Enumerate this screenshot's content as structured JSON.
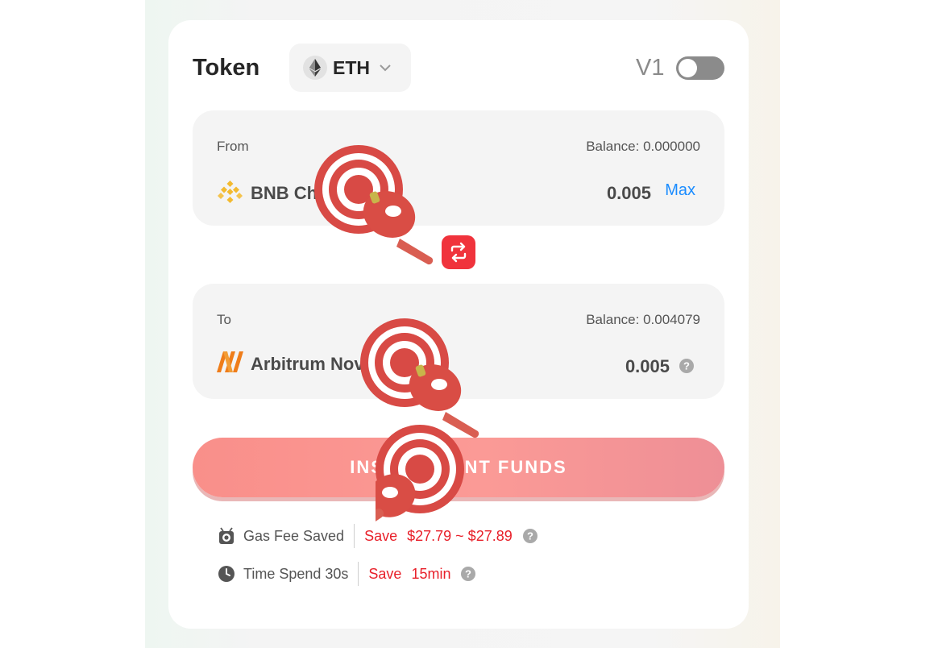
{
  "header": {
    "token_label": "Token",
    "selected_token": "ETH",
    "version_label": "V1"
  },
  "from": {
    "label": "From",
    "balance": "Balance: 0.000000",
    "chain": "BNB Chain",
    "amount": "0.005",
    "max_label": "Max"
  },
  "to": {
    "label": "To",
    "balance": "Balance: 0.004079",
    "chain": "Arbitrum Nova",
    "amount": "0.005"
  },
  "action": {
    "button_label": "INSUFFICIENT FUNDS"
  },
  "info": {
    "gas_label": "Gas Fee Saved",
    "gas_save": "Save",
    "gas_value": "$27.79 ~ $27.89",
    "time_label": "Time Spend 30s",
    "time_save": "Save",
    "time_value": "15min"
  },
  "colors": {
    "accent_red": "#f0333c",
    "link_blue": "#1a8cff",
    "button_pink": "#fb9a96"
  },
  "icons": [
    "eth-icon",
    "chevron-down-icon",
    "bnb-chain-icon",
    "arbitrum-nova-icon",
    "swap-icon",
    "help-icon",
    "gas-icon",
    "clock-icon"
  ]
}
